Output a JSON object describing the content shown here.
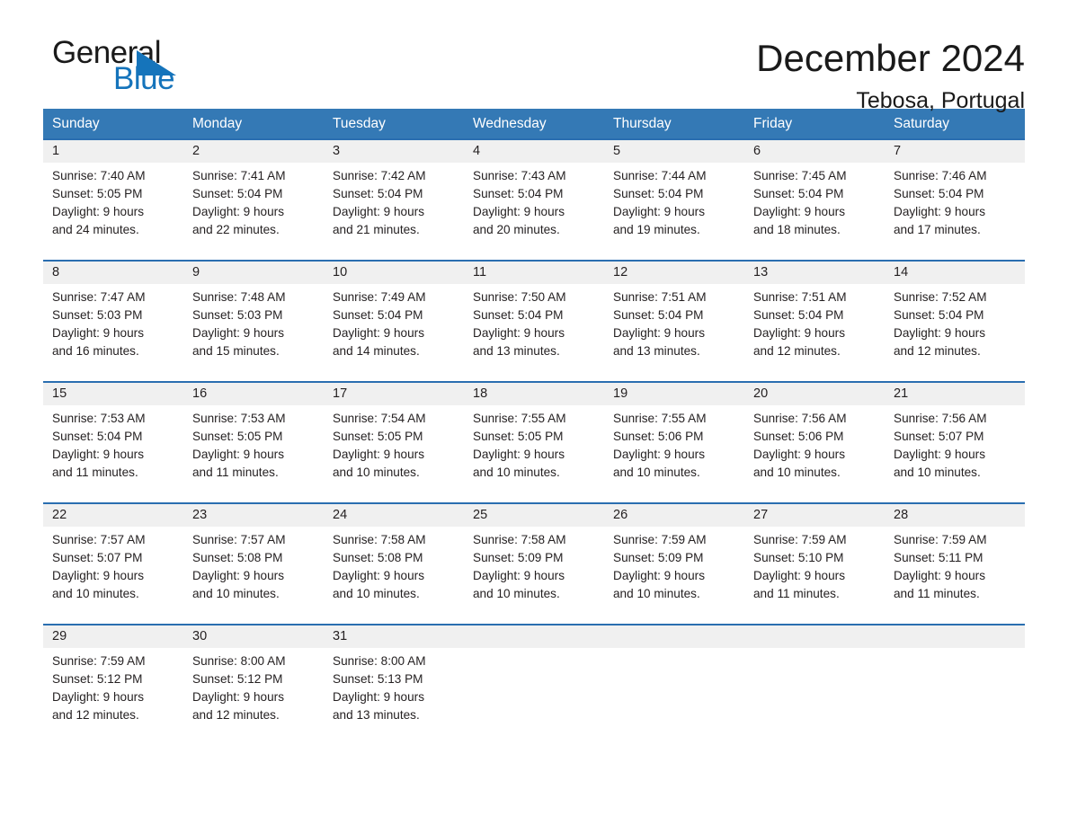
{
  "brand": {
    "name_part1": "General",
    "name_part2": "Blue",
    "accent_color": "#1574bb"
  },
  "header": {
    "title": "December 2024",
    "subtitle": "Tebosa, Portugal"
  },
  "theme": {
    "header_row_bg": "#3479b5",
    "week_divider": "#2a6eb0",
    "daynum_band_bg": "#f0f0f0",
    "text_color": "#231f20"
  },
  "weekdays": [
    "Sunday",
    "Monday",
    "Tuesday",
    "Wednesday",
    "Thursday",
    "Friday",
    "Saturday"
  ],
  "weeks": [
    {
      "days": [
        {
          "num": "1",
          "sunrise": "Sunrise: 7:40 AM",
          "sunset": "Sunset: 5:05 PM",
          "daylight_line1": "Daylight: 9 hours",
          "daylight_line2": "and 24 minutes."
        },
        {
          "num": "2",
          "sunrise": "Sunrise: 7:41 AM",
          "sunset": "Sunset: 5:04 PM",
          "daylight_line1": "Daylight: 9 hours",
          "daylight_line2": "and 22 minutes."
        },
        {
          "num": "3",
          "sunrise": "Sunrise: 7:42 AM",
          "sunset": "Sunset: 5:04 PM",
          "daylight_line1": "Daylight: 9 hours",
          "daylight_line2": "and 21 minutes."
        },
        {
          "num": "4",
          "sunrise": "Sunrise: 7:43 AM",
          "sunset": "Sunset: 5:04 PM",
          "daylight_line1": "Daylight: 9 hours",
          "daylight_line2": "and 20 minutes."
        },
        {
          "num": "5",
          "sunrise": "Sunrise: 7:44 AM",
          "sunset": "Sunset: 5:04 PM",
          "daylight_line1": "Daylight: 9 hours",
          "daylight_line2": "and 19 minutes."
        },
        {
          "num": "6",
          "sunrise": "Sunrise: 7:45 AM",
          "sunset": "Sunset: 5:04 PM",
          "daylight_line1": "Daylight: 9 hours",
          "daylight_line2": "and 18 minutes."
        },
        {
          "num": "7",
          "sunrise": "Sunrise: 7:46 AM",
          "sunset": "Sunset: 5:04 PM",
          "daylight_line1": "Daylight: 9 hours",
          "daylight_line2": "and 17 minutes."
        }
      ]
    },
    {
      "days": [
        {
          "num": "8",
          "sunrise": "Sunrise: 7:47 AM",
          "sunset": "Sunset: 5:03 PM",
          "daylight_line1": "Daylight: 9 hours",
          "daylight_line2": "and 16 minutes."
        },
        {
          "num": "9",
          "sunrise": "Sunrise: 7:48 AM",
          "sunset": "Sunset: 5:03 PM",
          "daylight_line1": "Daylight: 9 hours",
          "daylight_line2": "and 15 minutes."
        },
        {
          "num": "10",
          "sunrise": "Sunrise: 7:49 AM",
          "sunset": "Sunset: 5:04 PM",
          "daylight_line1": "Daylight: 9 hours",
          "daylight_line2": "and 14 minutes."
        },
        {
          "num": "11",
          "sunrise": "Sunrise: 7:50 AM",
          "sunset": "Sunset: 5:04 PM",
          "daylight_line1": "Daylight: 9 hours",
          "daylight_line2": "and 13 minutes."
        },
        {
          "num": "12",
          "sunrise": "Sunrise: 7:51 AM",
          "sunset": "Sunset: 5:04 PM",
          "daylight_line1": "Daylight: 9 hours",
          "daylight_line2": "and 13 minutes."
        },
        {
          "num": "13",
          "sunrise": "Sunrise: 7:51 AM",
          "sunset": "Sunset: 5:04 PM",
          "daylight_line1": "Daylight: 9 hours",
          "daylight_line2": "and 12 minutes."
        },
        {
          "num": "14",
          "sunrise": "Sunrise: 7:52 AM",
          "sunset": "Sunset: 5:04 PM",
          "daylight_line1": "Daylight: 9 hours",
          "daylight_line2": "and 12 minutes."
        }
      ]
    },
    {
      "days": [
        {
          "num": "15",
          "sunrise": "Sunrise: 7:53 AM",
          "sunset": "Sunset: 5:04 PM",
          "daylight_line1": "Daylight: 9 hours",
          "daylight_line2": "and 11 minutes."
        },
        {
          "num": "16",
          "sunrise": "Sunrise: 7:53 AM",
          "sunset": "Sunset: 5:05 PM",
          "daylight_line1": "Daylight: 9 hours",
          "daylight_line2": "and 11 minutes."
        },
        {
          "num": "17",
          "sunrise": "Sunrise: 7:54 AM",
          "sunset": "Sunset: 5:05 PM",
          "daylight_line1": "Daylight: 9 hours",
          "daylight_line2": "and 10 minutes."
        },
        {
          "num": "18",
          "sunrise": "Sunrise: 7:55 AM",
          "sunset": "Sunset: 5:05 PM",
          "daylight_line1": "Daylight: 9 hours",
          "daylight_line2": "and 10 minutes."
        },
        {
          "num": "19",
          "sunrise": "Sunrise: 7:55 AM",
          "sunset": "Sunset: 5:06 PM",
          "daylight_line1": "Daylight: 9 hours",
          "daylight_line2": "and 10 minutes."
        },
        {
          "num": "20",
          "sunrise": "Sunrise: 7:56 AM",
          "sunset": "Sunset: 5:06 PM",
          "daylight_line1": "Daylight: 9 hours",
          "daylight_line2": "and 10 minutes."
        },
        {
          "num": "21",
          "sunrise": "Sunrise: 7:56 AM",
          "sunset": "Sunset: 5:07 PM",
          "daylight_line1": "Daylight: 9 hours",
          "daylight_line2": "and 10 minutes."
        }
      ]
    },
    {
      "days": [
        {
          "num": "22",
          "sunrise": "Sunrise: 7:57 AM",
          "sunset": "Sunset: 5:07 PM",
          "daylight_line1": "Daylight: 9 hours",
          "daylight_line2": "and 10 minutes."
        },
        {
          "num": "23",
          "sunrise": "Sunrise: 7:57 AM",
          "sunset": "Sunset: 5:08 PM",
          "daylight_line1": "Daylight: 9 hours",
          "daylight_line2": "and 10 minutes."
        },
        {
          "num": "24",
          "sunrise": "Sunrise: 7:58 AM",
          "sunset": "Sunset: 5:08 PM",
          "daylight_line1": "Daylight: 9 hours",
          "daylight_line2": "and 10 minutes."
        },
        {
          "num": "25",
          "sunrise": "Sunrise: 7:58 AM",
          "sunset": "Sunset: 5:09 PM",
          "daylight_line1": "Daylight: 9 hours",
          "daylight_line2": "and 10 minutes."
        },
        {
          "num": "26",
          "sunrise": "Sunrise: 7:59 AM",
          "sunset": "Sunset: 5:09 PM",
          "daylight_line1": "Daylight: 9 hours",
          "daylight_line2": "and 10 minutes."
        },
        {
          "num": "27",
          "sunrise": "Sunrise: 7:59 AM",
          "sunset": "Sunset: 5:10 PM",
          "daylight_line1": "Daylight: 9 hours",
          "daylight_line2": "and 11 minutes."
        },
        {
          "num": "28",
          "sunrise": "Sunrise: 7:59 AM",
          "sunset": "Sunset: 5:11 PM",
          "daylight_line1": "Daylight: 9 hours",
          "daylight_line2": "and 11 minutes."
        }
      ]
    },
    {
      "days": [
        {
          "num": "29",
          "sunrise": "Sunrise: 7:59 AM",
          "sunset": "Sunset: 5:12 PM",
          "daylight_line1": "Daylight: 9 hours",
          "daylight_line2": "and 12 minutes."
        },
        {
          "num": "30",
          "sunrise": "Sunrise: 8:00 AM",
          "sunset": "Sunset: 5:12 PM",
          "daylight_line1": "Daylight: 9 hours",
          "daylight_line2": "and 12 minutes."
        },
        {
          "num": "31",
          "sunrise": "Sunrise: 8:00 AM",
          "sunset": "Sunset: 5:13 PM",
          "daylight_line1": "Daylight: 9 hours",
          "daylight_line2": "and 13 minutes."
        },
        {
          "num": "",
          "sunrise": "",
          "sunset": "",
          "daylight_line1": "",
          "daylight_line2": ""
        },
        {
          "num": "",
          "sunrise": "",
          "sunset": "",
          "daylight_line1": "",
          "daylight_line2": ""
        },
        {
          "num": "",
          "sunrise": "",
          "sunset": "",
          "daylight_line1": "",
          "daylight_line2": ""
        },
        {
          "num": "",
          "sunrise": "",
          "sunset": "",
          "daylight_line1": "",
          "daylight_line2": ""
        }
      ]
    }
  ]
}
